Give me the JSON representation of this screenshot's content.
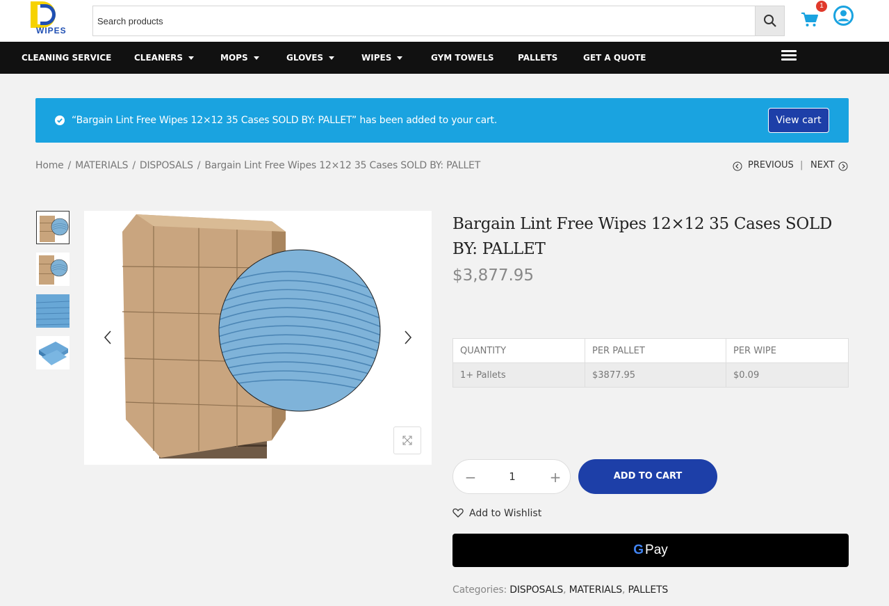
{
  "header": {
    "logo_text": "WIPES",
    "search_placeholder": "Search products",
    "cart_count": "1"
  },
  "nav": {
    "items": [
      {
        "label": "CLEANING SERVICE",
        "dropdown": false
      },
      {
        "label": "CLEANERS",
        "dropdown": true
      },
      {
        "label": "MOPS",
        "dropdown": true
      },
      {
        "label": "GLOVES",
        "dropdown": true
      },
      {
        "label": "WIPES",
        "dropdown": true
      },
      {
        "label": "GYM TOWELS",
        "dropdown": false
      },
      {
        "label": "PALLETS",
        "dropdown": false
      },
      {
        "label": "GET A QUOTE",
        "dropdown": false
      }
    ]
  },
  "notice": {
    "message": "“Bargain Lint Free Wipes 12×12 35 Cases SOLD BY: PALLET” has been added to your cart.",
    "button": "View cart",
    "color": "#1aa3e0"
  },
  "breadcrumb": {
    "items": [
      "Home",
      "MATERIALS",
      "DISPOSALS",
      "Bargain Lint Free Wipes 12×12 35 Cases SOLD BY: PALLET"
    ],
    "separator": "/"
  },
  "pagination": {
    "previous": "PREVIOUS",
    "separator": "|",
    "next": "NEXT"
  },
  "product": {
    "title": "Bargain Lint Free Wipes 12×12 35 Cases SOLD BY: PALLET",
    "price": "$3,877.95",
    "table": {
      "headers": [
        "QUANTITY",
        "PER PALLET",
        "PER WIPE"
      ],
      "rows": [
        [
          "1+ Pallets",
          "$3877.95",
          "$0.09"
        ]
      ]
    },
    "quantity": "1",
    "add_to_cart": "ADD TO CART",
    "wishlist": "Add to Wishlist",
    "gpay_g": "G",
    "gpay_label": "Pay",
    "categories_label": "Categories:",
    "categories": [
      "DISPOSALS",
      "MATERIALS",
      "PALLETS"
    ]
  },
  "colors": {
    "brand_blue": "#1d3fa8",
    "notice_blue": "#1aa3e0",
    "nav_bg": "#111111",
    "badge_red": "#e0392b"
  }
}
